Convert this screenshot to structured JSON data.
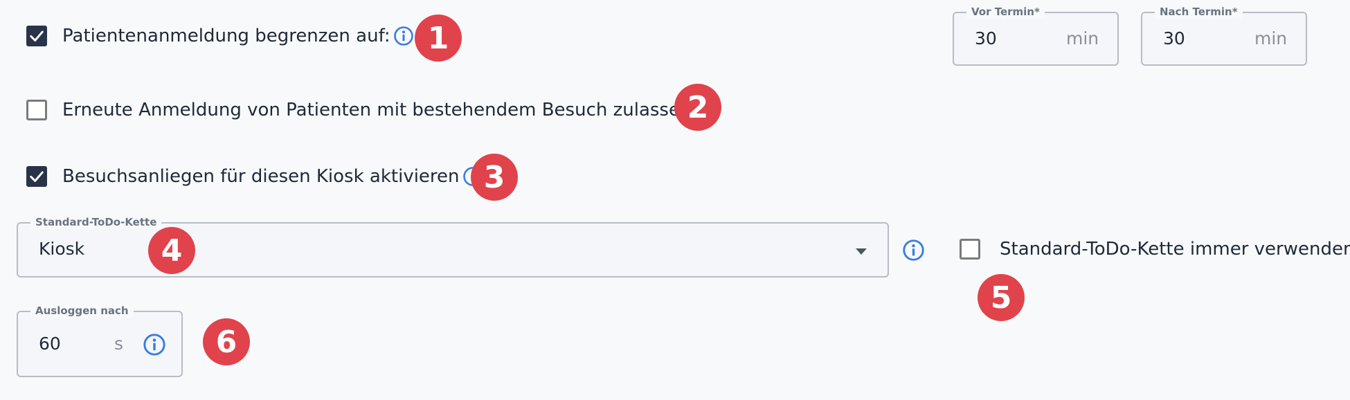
{
  "settings": {
    "limit_registration": {
      "label": "Patientenanmeldung begrenzen auf:",
      "checked": true,
      "badge": "1"
    },
    "before_appointment": {
      "label": "Vor Termin*",
      "value": "30",
      "unit": "min"
    },
    "after_appointment": {
      "label": "Nach Termin*",
      "value": "30",
      "unit": "min"
    },
    "re_registration": {
      "label": "Erneute Anmeldung von Patienten mit bestehendem Besuch zulassen",
      "checked": false,
      "badge": "2"
    },
    "visit_concerns": {
      "label": "Besuchsanliegen für diesen Kiosk aktivieren",
      "checked": true,
      "badge": "3"
    },
    "default_todo_chain": {
      "label": "Standard-ToDo-Kette",
      "value": "Kiosk",
      "badge": "4"
    },
    "always_use_default": {
      "label": "Standard-ToDo-Kette immer verwenden",
      "checked": false,
      "badge": "5"
    },
    "logout_after": {
      "label": "Ausloggen nach",
      "value": "60",
      "unit": "s",
      "badge": "6"
    }
  },
  "icons": {
    "info": "info-icon",
    "check": "checkmark-icon",
    "dropdown": "caret-down-icon"
  },
  "colors": {
    "checkbox_checked": "#2a3448",
    "info_icon": "#3b7be0",
    "badge": "#e0434b",
    "background": "#f8f9fb"
  }
}
